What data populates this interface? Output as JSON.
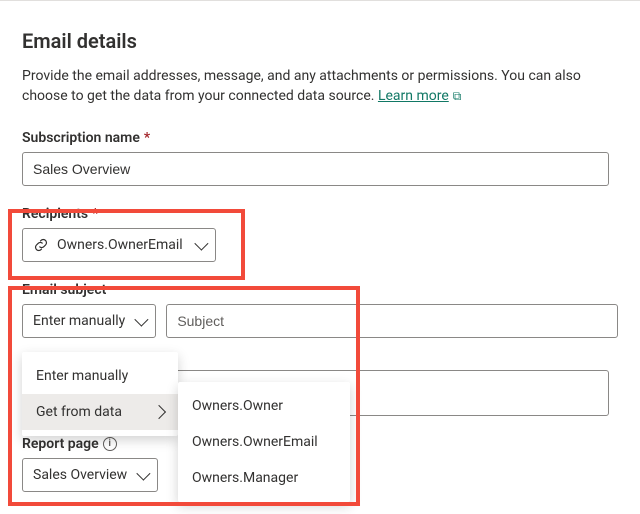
{
  "header": {
    "title": "Email details",
    "intro": "Provide the email addresses, message, and any attachments or permissions. You can also choose to get the data from your connected data source.",
    "learn_more": "Learn more"
  },
  "subscription_name": {
    "label": "Subscription name",
    "value": "Sales Overview"
  },
  "recipients": {
    "label": "Recipients",
    "chip_value": "Owners.OwnerEmail"
  },
  "email_subject": {
    "label": "Email subject",
    "mode_button": "Enter manually",
    "placeholder": "Subject",
    "menu": {
      "item_manual": "Enter manually",
      "item_from_data": "Get from data",
      "submenu": [
        "Owners.Owner",
        "Owners.OwnerEmail",
        "Owners.Manager"
      ]
    }
  },
  "report_page": {
    "label": "Report page",
    "value": "Sales Overview"
  }
}
